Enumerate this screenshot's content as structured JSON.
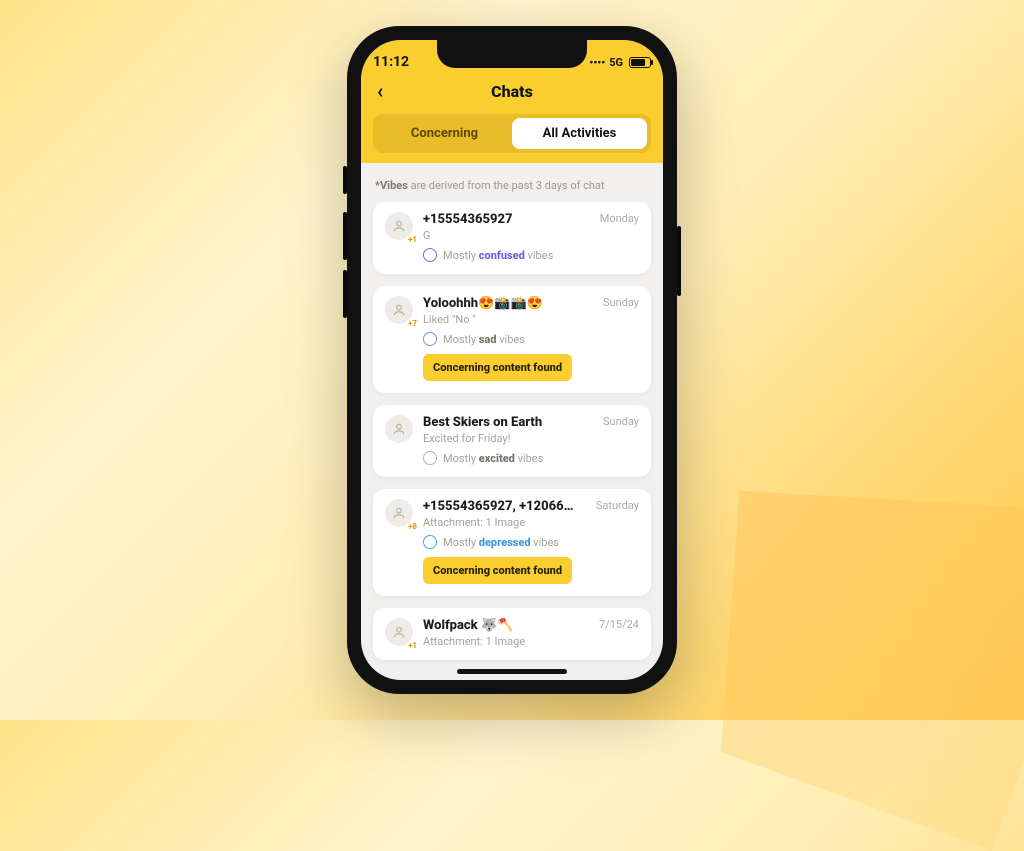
{
  "status": {
    "time": "11:12",
    "net": "5G",
    "signal_icon": "••••"
  },
  "header": {
    "title": "Chats"
  },
  "tabs": {
    "concerning": "Concerning",
    "all": "All Activities",
    "active": "all"
  },
  "note": {
    "prefix": "*Vibes",
    "rest": " are derived from the past 3 days of chat"
  },
  "flag_text": "Concerning content found",
  "chats": [
    {
      "avatar_badge": "+1",
      "title": "+15554365927",
      "subtitle": "G",
      "day": "Monday",
      "vibe_pre": "Mostly ",
      "vibe_word": "confused",
      "vibe_post": " vibes",
      "vibe_class": "confused",
      "vibe_bclass": "b-confused",
      "flag": false
    },
    {
      "avatar_badge": "+7",
      "title": "Yoloohhh😍📸📸😍",
      "subtitle": "Liked \"No \"",
      "day": "Sunday",
      "vibe_pre": "Mostly ",
      "vibe_word": "sad",
      "vibe_post": " vibes",
      "vibe_class": "sad",
      "vibe_bclass": "b-sad",
      "flag": true
    },
    {
      "avatar_badge": "",
      "title": "Best Skiers on Earth",
      "subtitle": "Excited for Friday!",
      "day": "Sunday",
      "vibe_pre": "Mostly ",
      "vibe_word": "excited",
      "vibe_post": " vibes",
      "vibe_class": "excited",
      "vibe_bclass": "b-excited",
      "flag": false
    },
    {
      "avatar_badge": "+8",
      "title": "+15554365927, +120662…",
      "subtitle": "Attachment: 1 Image",
      "day": "Saturday",
      "vibe_pre": "Mostly ",
      "vibe_word": "depressed",
      "vibe_post": " vibes",
      "vibe_class": "depressed",
      "vibe_bclass": "b-depressed",
      "flag": true
    },
    {
      "avatar_badge": "+1",
      "title": "Wolfpack 🐺🪓",
      "subtitle": "Attachment: 1 Image",
      "day": "7/15/24",
      "vibe_pre": "",
      "vibe_word": "",
      "vibe_post": "",
      "vibe_class": "",
      "vibe_bclass": "",
      "flag": false
    }
  ]
}
